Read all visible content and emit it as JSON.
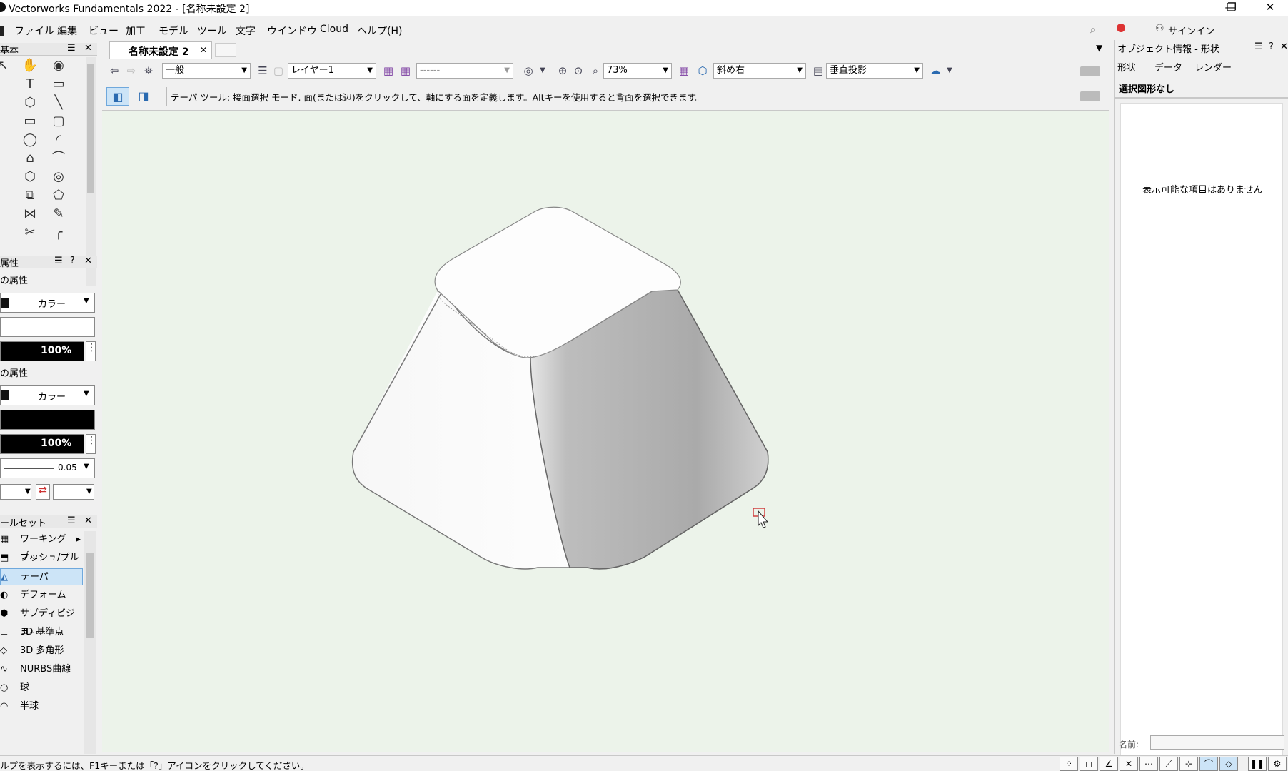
{
  "window": {
    "title": "Vectorworks Fundamentals 2022 - [名称未設定 2]",
    "minimize_glyph": "—",
    "restore_glyph": "❐",
    "close_glyph": "✕"
  },
  "menu": {
    "items": [
      "ファイル",
      "編集",
      "ビュー",
      "モデル",
      "加工",
      "ツール",
      "文字",
      "ウインドウ",
      "Cloud",
      "ヘルプ(H)"
    ],
    "search_icon": "search-icon",
    "notification_icon": "alert-icon",
    "signin_label": "サインイン"
  },
  "left": {
    "basic_palette_title": "基本",
    "attributes_title": "属性",
    "fill_section": "の属性",
    "fill_type": "カラー",
    "fill_opacity": "100%",
    "line_section": "の属性",
    "line_type": "カラー",
    "line_opacity": "100%",
    "line_weight": "0.05",
    "toolset_title": "ールセット",
    "toolset_items": [
      "ワーキングプ...",
      "プッシュ/プル",
      "テーパ",
      "デフォーム",
      "サブディビジョ...",
      "3D 基準点",
      "3D 多角形",
      "NURBS曲線",
      "球",
      "半球"
    ],
    "toolset_selected": "テーパ"
  },
  "doc": {
    "tab_label": "名称未設定 2",
    "class_combo": "一般",
    "layer_combo": "レイヤー1",
    "zoom_combo": "73%",
    "view_combo": "斜め右",
    "projection_combo": "垂直投影",
    "mode_help": "テーパ ツール: 接面選択 モード. 面(または辺)をクリックして、軸にする面を定義します。Altキーを使用すると背面を選択できます。"
  },
  "right": {
    "title": "オブジェクト情報 - 形状",
    "tabs": [
      "形状",
      "データ",
      "レンダー"
    ],
    "selection_label": "選択図形なし",
    "empty_message": "表示可能な項目はありません",
    "name_label": "名前:"
  },
  "status": {
    "help_text": "ルプを表示するには、F1キーまたは「?」アイコンをクリックしてください。"
  },
  "colors": {
    "canvas_bg": "#ecf3ea",
    "selection_bg": "#cce4f7",
    "cursor_box": "#d04040"
  }
}
